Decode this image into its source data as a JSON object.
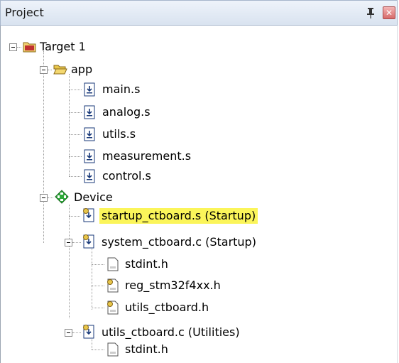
{
  "panel": {
    "title": "Project"
  },
  "tree": {
    "target": "Target 1",
    "app_folder": "app",
    "app_files": [
      "main.s",
      "analog.s",
      "utils.s",
      "measurement.s",
      "control.s"
    ],
    "device": "Device",
    "startup": "startup_ctboard.s (Startup)",
    "system": "system_ctboard.c (Startup)",
    "system_children": [
      "stdint.h",
      "reg_stm32f4xx.h",
      "utils_ctboard.h"
    ],
    "utils": "utils_ctboard.c (Utilities)",
    "utils_children": [
      "stdint.h"
    ]
  },
  "colors": {
    "highlight": "#fbf55a",
    "folder": "#e8c64a",
    "device": "#2eaa3a"
  }
}
